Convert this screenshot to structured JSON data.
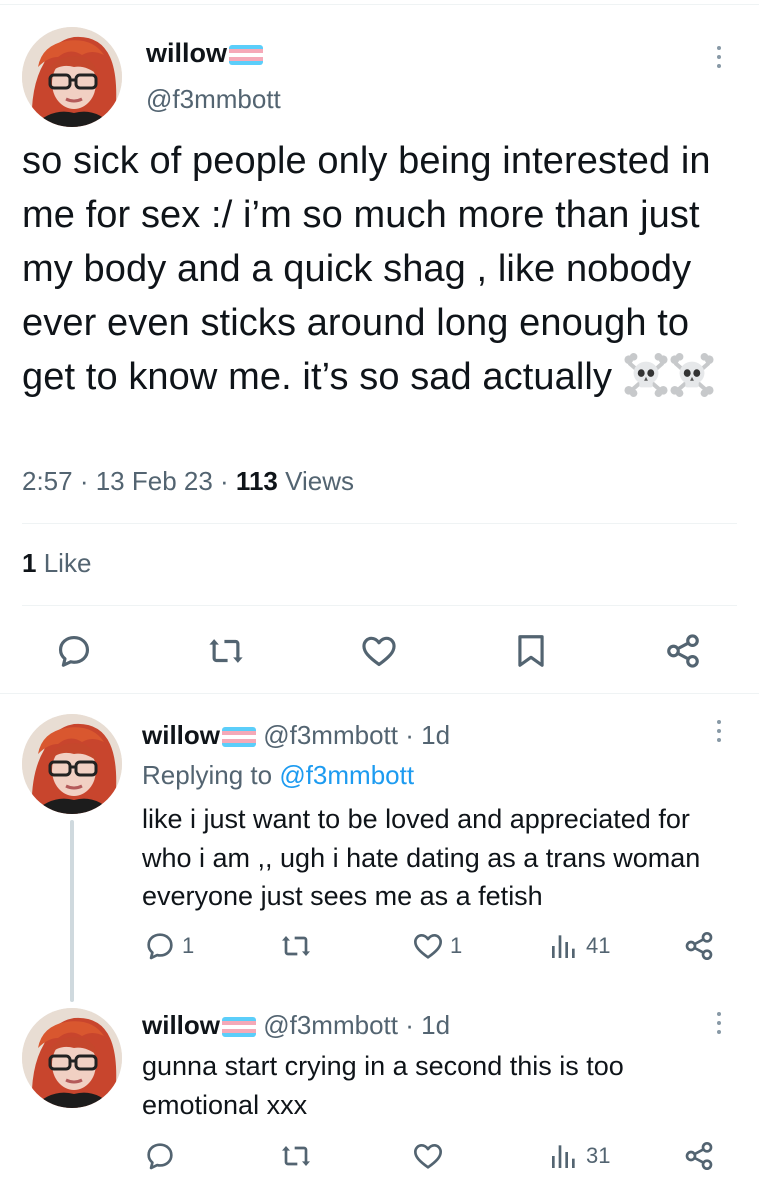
{
  "main_tweet": {
    "display_name": "willow",
    "handle": "@f3mmbott",
    "text": "so sick of people only being interested in me for sex :/ i’m so much more than just my body and a quick shag , like nobody ever even sticks around long enough to get to know me. it’s so sad actually",
    "emoji": [
      "skull-and-crossbones",
      "skull-and-crossbones"
    ],
    "time": "2:57",
    "date": "13 Feb 23",
    "views_count": "113",
    "views_label": "Views",
    "meta_sep": " · ",
    "likes_count": "1",
    "likes_label": "Like"
  },
  "flag_colors": [
    "#5bcefa",
    "#f5a9b8",
    "#ffffff",
    "#f5a9b8",
    "#5bcefa"
  ],
  "replies": [
    {
      "display_name": "willow",
      "handle": "@f3mmbott",
      "age": "· 1d",
      "replying_prefix": "Replying to",
      "replying_to": "@f3mmbott",
      "text": "like i just want to be loved and appreciated for who i am ,, ugh i hate dating as a trans woman everyone just sees me as a fetish",
      "reply_count": "1",
      "retweet_count": "",
      "like_count": "1",
      "view_count": "41"
    },
    {
      "display_name": "willow",
      "handle": "@f3mmbott",
      "age": "· 1d",
      "text": "gunna start crying in a second this is too emotional xxx",
      "reply_count": "",
      "retweet_count": "",
      "like_count": "",
      "view_count": "31"
    }
  ],
  "colors": {
    "text": "#0f1419",
    "muted": "#536471",
    "link": "#1d9bf0",
    "border": "#eff3f4"
  },
  "icons": [
    "reply-icon",
    "retweet-icon",
    "like-icon",
    "bookmark-icon",
    "share-icon",
    "views-icon",
    "more-icon"
  ]
}
